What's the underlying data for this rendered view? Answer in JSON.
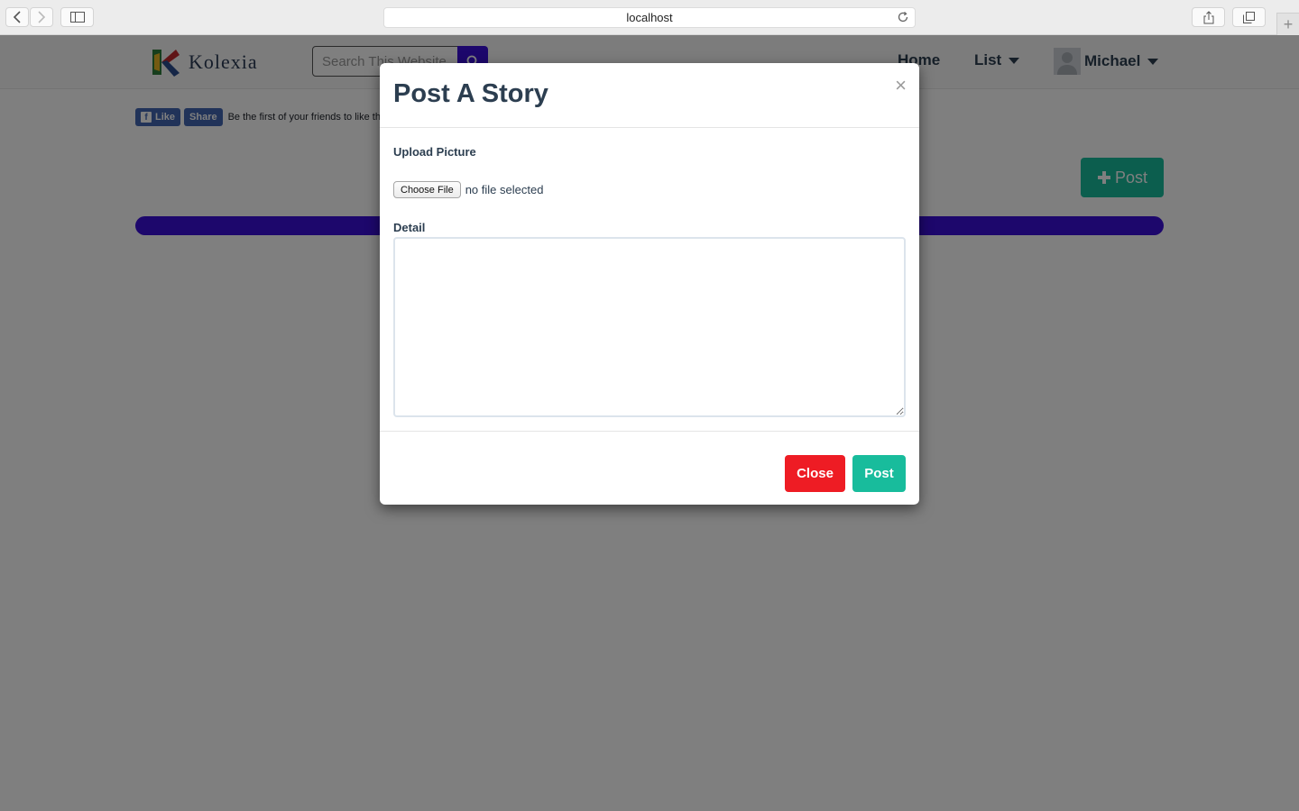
{
  "browser": {
    "url": "localhost"
  },
  "site": {
    "brand_name": "Kolexia",
    "search_placeholder": "Search This Website",
    "nav": {
      "home_label": "Home",
      "list_label": "List",
      "user_name": "Michael"
    },
    "facebook": {
      "like_label": "Like",
      "share_label": "Share",
      "social_text": "Be the first of your friends to like this."
    },
    "post_button_label": "Post",
    "colors": {
      "accent_purple": "#3a0fd8",
      "success_green": "#18bc9c",
      "danger_red": "#ee1c24",
      "heading": "#2c3e50"
    }
  },
  "modal": {
    "title": "Post A Story",
    "close_symbol": "×",
    "upload_label": "Upload Picture",
    "choose_file_label": "Choose File",
    "file_status": "no file selected",
    "detail_label": "Detail",
    "detail_value": "",
    "close_button_label": "Close",
    "post_button_label": "Post"
  }
}
